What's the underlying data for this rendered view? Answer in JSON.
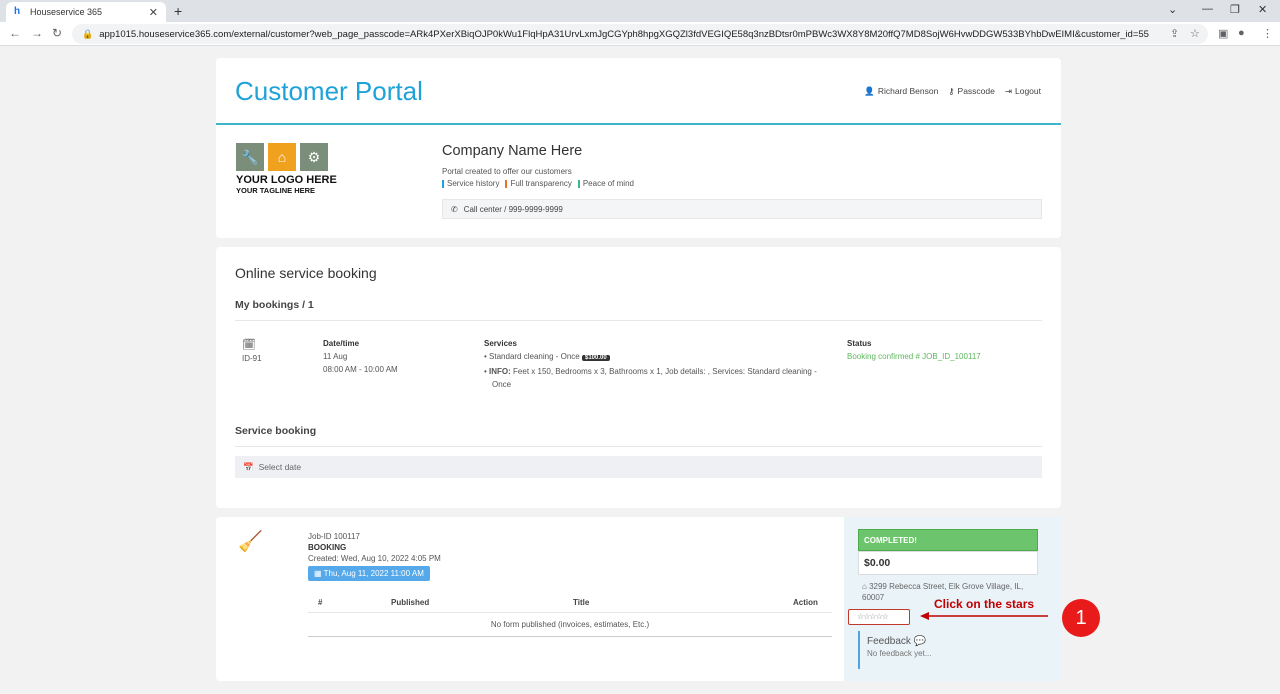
{
  "browser": {
    "tab_title": "Houseservice 365",
    "tab_close": "✕",
    "new_tab": "+",
    "url": "app1015.houseservice365.com/external/customer?web_page_passcode=ARk4PXerXBiqOJP0kWu1FlqHpA31UrvLxmJgCGYph8hpgXGQZl3fdVEGIQE58q3nzBDtsr0mPBWc3WX8Y8M20ffQ7MD8SojW6HvwDDGW533BYhbDwEIMI&customer_id=55"
  },
  "header": {
    "title": "Customer Portal",
    "user_name": "Richard Benson",
    "passcode_label": "Passcode",
    "logout_label": "Logout"
  },
  "company": {
    "logo_line1": "YOUR LOGO HERE",
    "logo_line2": "YOUR TAGLINE HERE",
    "name": "Company Name Here",
    "subtitle": "Portal created to offer our customers",
    "tags": [
      {
        "label": "Service history",
        "color": "#1fa2d8"
      },
      {
        "label": "Full transparency",
        "color": "#e8732a"
      },
      {
        "label": "Peace of mind",
        "color": "#3fb58a"
      }
    ],
    "call_center": "Call center / 999-9999-9999"
  },
  "booking": {
    "section_title": "Online service booking",
    "my_bookings": "My bookings / 1",
    "item": {
      "id": "ID-91",
      "date_header": "Date/time",
      "date": "11 Aug",
      "time": "08:00 AM - 10:00 AM",
      "services_header": "Services",
      "service1": "Standard cleaning - Once",
      "service1_price": "$100.00",
      "info_label": "INFO:",
      "info_text": "Feet x 150, Bedrooms x 3, Bathrooms x 1, Job details: , Services: Standard cleaning - Once",
      "status_header": "Status",
      "status": "Booking confirmed # JOB_ID_100117"
    },
    "service_booking_title": "Service booking",
    "select_date": "Select date"
  },
  "job": {
    "job_id": "Job-ID 100117",
    "type": "BOOKING",
    "created": "Created: Wed, Aug 10, 2022 4:05 PM",
    "date_chip": "Thu, Aug 11, 2022 11:00 AM",
    "table": {
      "col_num": "#",
      "col_published": "Published",
      "col_title": "Title",
      "col_action": "Action",
      "empty": "No form published (invoices, estimates, Etc.)"
    },
    "status": "COMPLETED!",
    "amount": "$0.00",
    "address": "3299 Rebecca Street, Elk Grove Village, IL, 60007",
    "stars": "☆☆☆☆☆",
    "feedback_title": "Feedback",
    "feedback_text": "No feedback yet..."
  },
  "annotation": {
    "text": "Click on the stars",
    "badge": "1",
    "color": "#c00000"
  }
}
